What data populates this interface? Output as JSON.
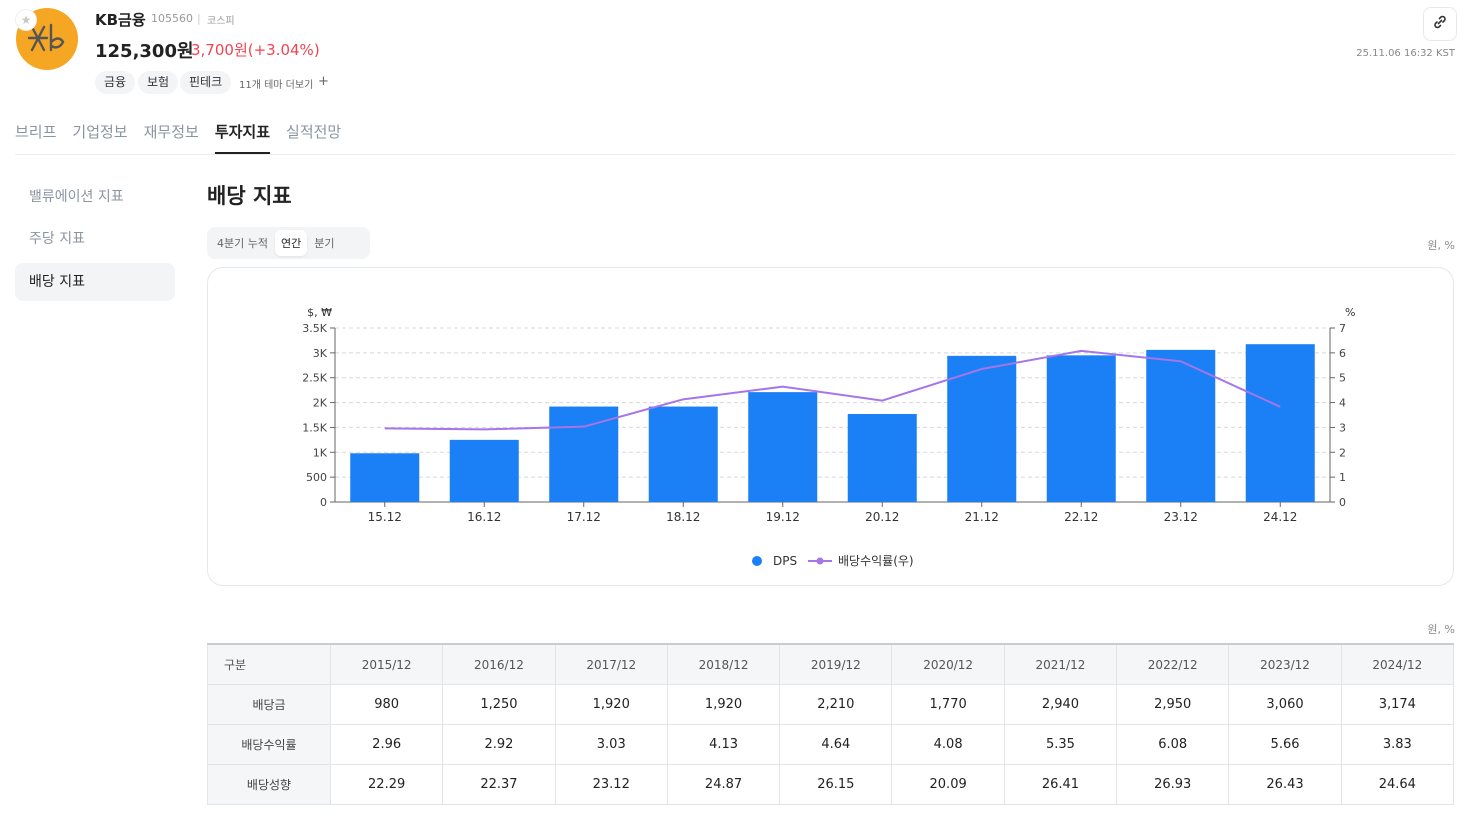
{
  "header": {
    "stock_name": "KB금융",
    "stock_code": "105560",
    "market": "코스피",
    "price": "125,300원",
    "change": "3,700원(+3.04%)",
    "change_color": "#f04452",
    "tags": [
      "금융",
      "보험",
      "핀테크"
    ],
    "more_themes": "11개 테마 더보기",
    "plus_icon": "+",
    "timestamp": "25.11.06 16:32 KST",
    "logo_color": "#f5a623"
  },
  "tabs": [
    {
      "label": "브리프",
      "active": false
    },
    {
      "label": "기업정보",
      "active": false
    },
    {
      "label": "재무정보",
      "active": false
    },
    {
      "label": "투자지표",
      "active": true
    },
    {
      "label": "실적전망",
      "active": false
    }
  ],
  "sidebar": {
    "items": [
      {
        "label": "밸류에이션 지표",
        "active": false
      },
      {
        "label": "주당 지표",
        "active": false
      },
      {
        "label": "배당 지표",
        "active": true
      }
    ]
  },
  "main": {
    "title": "배당 지표",
    "period_options": [
      {
        "label": "4분기 누적",
        "active": false
      },
      {
        "label": "연간",
        "active": true
      },
      {
        "label": "분기",
        "active": false
      }
    ],
    "unit": "원, %"
  },
  "chart_data": {
    "type": "bar",
    "categories": [
      "15.12",
      "16.12",
      "17.12",
      "18.12",
      "19.12",
      "20.12",
      "21.12",
      "22.12",
      "23.12",
      "24.12"
    ],
    "series": [
      {
        "name": "DPS",
        "type": "bar",
        "axis": "left",
        "color": "#1b7ff5",
        "values": [
          980,
          1250,
          1920,
          1920,
          2210,
          1770,
          2940,
          2950,
          3060,
          3174
        ]
      },
      {
        "name": "배당수익률(우)",
        "type": "line",
        "axis": "right",
        "color": "#a675e8",
        "values": [
          2.96,
          2.92,
          3.03,
          4.13,
          4.64,
          4.08,
          5.35,
          6.08,
          5.66,
          3.83
        ]
      }
    ],
    "y_left": {
      "label": "$, ₩",
      "ticks": [
        "0",
        "500",
        "1K",
        "1.5K",
        "2K",
        "2.5K",
        "3K",
        "3.5K"
      ],
      "min": 0,
      "max": 3500
    },
    "y_right": {
      "label": "%",
      "ticks": [
        "0",
        "1",
        "2",
        "3",
        "4",
        "5",
        "6",
        "7"
      ],
      "min": 0,
      "max": 7
    },
    "grid": true,
    "legend": "bottom-center"
  },
  "table": {
    "unit": "원, %",
    "header": [
      "구분",
      "2015/12",
      "2016/12",
      "2017/12",
      "2018/12",
      "2019/12",
      "2020/12",
      "2021/12",
      "2022/12",
      "2023/12",
      "2024/12"
    ],
    "rows": [
      {
        "label": "배당금",
        "cells": [
          "980",
          "1,250",
          "1,920",
          "1,920",
          "2,210",
          "1,770",
          "2,940",
          "2,950",
          "3,060",
          "3,174"
        ]
      },
      {
        "label": "배당수익률",
        "cells": [
          "2.96",
          "2.92",
          "3.03",
          "4.13",
          "4.64",
          "4.08",
          "5.35",
          "6.08",
          "5.66",
          "3.83"
        ]
      },
      {
        "label": "배당성향",
        "cells": [
          "22.29",
          "22.37",
          "23.12",
          "24.87",
          "26.15",
          "20.09",
          "26.41",
          "26.93",
          "26.43",
          "24.64"
        ]
      }
    ]
  }
}
